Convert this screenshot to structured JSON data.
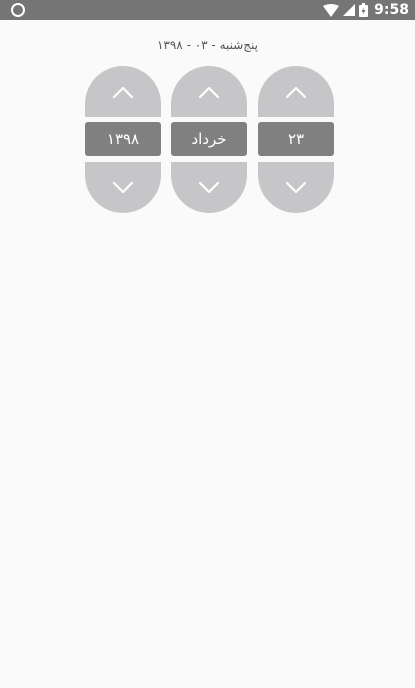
{
  "status_bar": {
    "time": "9:58",
    "left_icon": "circle-notification-icon",
    "right_icons": [
      "wifi-icon",
      "cell-signal-icon",
      "battery-icon"
    ]
  },
  "date_caption": "پنج‌شنبه - ۰۳ - ۱۳۹۸",
  "pickers": {
    "year": {
      "value": "۱۳۹۸",
      "up_icon": "chevron-up-icon",
      "down_icon": "chevron-down-icon"
    },
    "month": {
      "value": "خرداد",
      "up_icon": "chevron-up-icon",
      "down_icon": "chevron-down-icon"
    },
    "day": {
      "value": "۲۳",
      "up_icon": "chevron-up-icon",
      "down_icon": "chevron-down-icon"
    }
  },
  "colors": {
    "status_bar": "#757575",
    "background": "#fafafa",
    "spinner_button": "#c6c6c8",
    "spinner_value": "#808080"
  }
}
